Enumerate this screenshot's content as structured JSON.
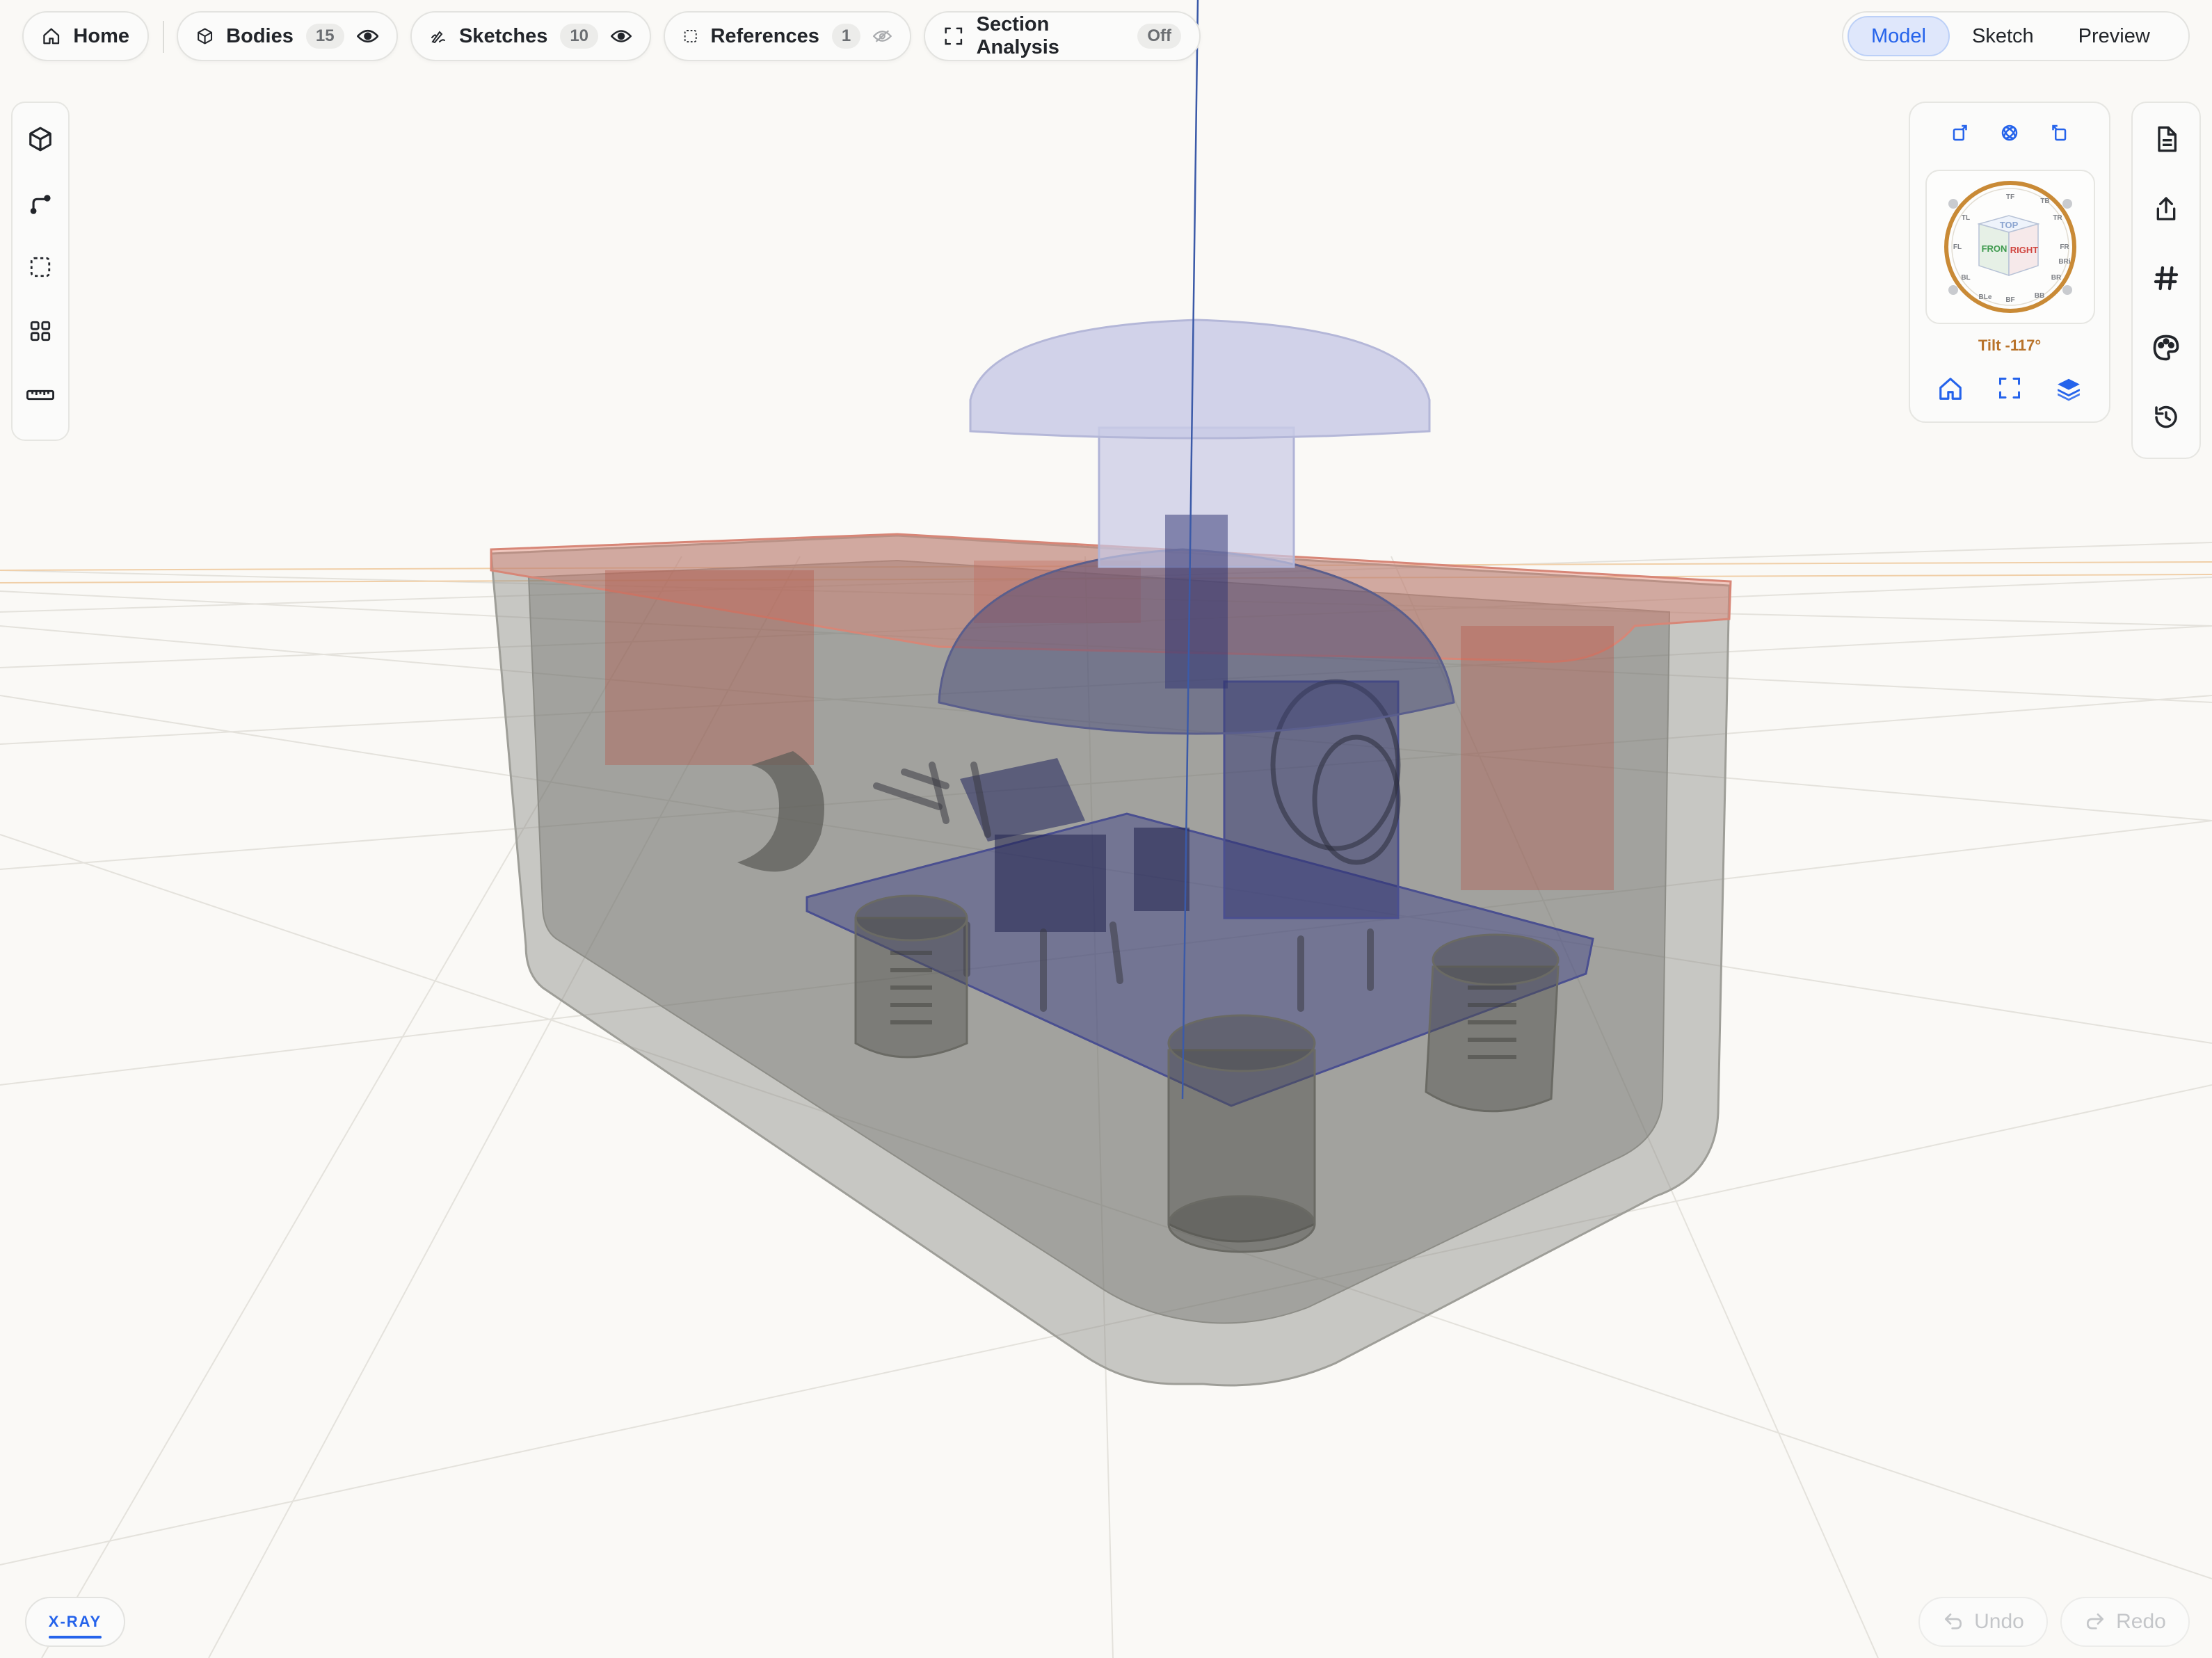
{
  "toolbar": {
    "home_label": "Home",
    "bodies_label": "Bodies",
    "bodies_count": "15",
    "sketches_label": "Sketches",
    "sketches_count": "10",
    "references_label": "References",
    "references_count": "1",
    "section_label": "Section Analysis",
    "section_state": "Off"
  },
  "modes": [
    "Model",
    "Sketch",
    "Preview"
  ],
  "active_mode": "Model",
  "left_tools": [
    "cube-icon",
    "sketch-path-icon",
    "selection-box-icon",
    "grid-icon",
    "ruler-icon"
  ],
  "right_tools": [
    "document-icon",
    "share-icon",
    "hash-icon",
    "palette-icon",
    "history-icon"
  ],
  "view_cube": {
    "faces": [
      "TOP",
      "FRON",
      "RIGHT"
    ],
    "ring_labels": [
      "TF",
      "TB",
      "TR",
      "FR",
      "BRi",
      "BR",
      "BB",
      "BF",
      "BLe",
      "BL",
      "FL",
      "TL"
    ],
    "tilt_label": "Tilt -117°"
  },
  "xray_label": "X-RAY",
  "undo_label": "Undo",
  "redo_label": "Redo",
  "colors": {
    "accent": "#2563eb",
    "tilt": "#b8732a",
    "ring": "#c98a36",
    "enclosure": "#7a7a74",
    "lid": "#e07c6c",
    "button": "#b9bcdc",
    "pcb": "#2e3270"
  }
}
